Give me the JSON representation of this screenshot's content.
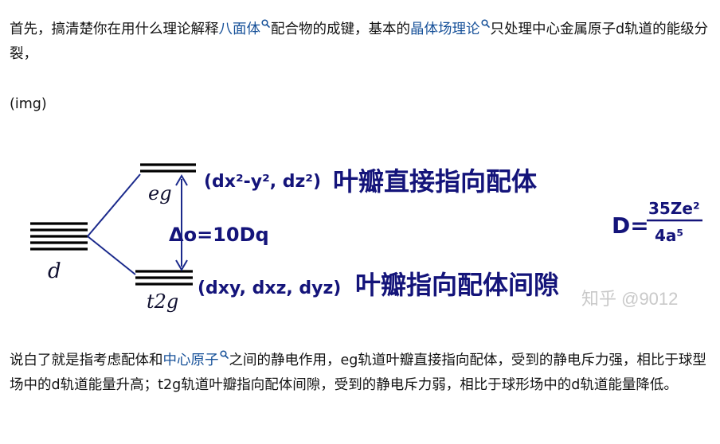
{
  "para1": {
    "text_a": "首先，搞清楚你在用什么理论解释",
    "link_a": "八面体",
    "text_b": "配合物的成键，基本的",
    "link_b": "晶体场理论",
    "text_c": "只处理中心金属原子d轨道的能级分裂，"
  },
  "image_placeholder": "(img)",
  "diagram": {
    "d_label": "d",
    "eg_label": "eg",
    "t2g_label": "t2g",
    "eg_orbitals": "(dx²-y², dz²)",
    "eg_note": "叶瓣直接指向配体",
    "t2g_orbitals": "(dxy, dxz, dyz)",
    "t2g_note": "叶瓣指向配体间隙",
    "delta": "Δo=10Dq",
    "formula_lhs": "D=",
    "formula_num": "35Ze²",
    "formula_den": "4a⁵",
    "watermark": "知乎 @9012",
    "ink_color": "#14147a"
  },
  "para2": {
    "text_a": "说白了就是指考虑配体和",
    "link_a": "中心原子",
    "text_b": "之间的静电作用，eg轨道叶瓣直接指向配体，受到的静电斥力强，相比于球型场中的d轨道能量升高；t2g轨道叶瓣指向配体间隙，受到的静电斥力弱，相比于球形场中的d轨道能量降低。"
  },
  "colors": {
    "link": "#175199",
    "text": "#121212"
  }
}
